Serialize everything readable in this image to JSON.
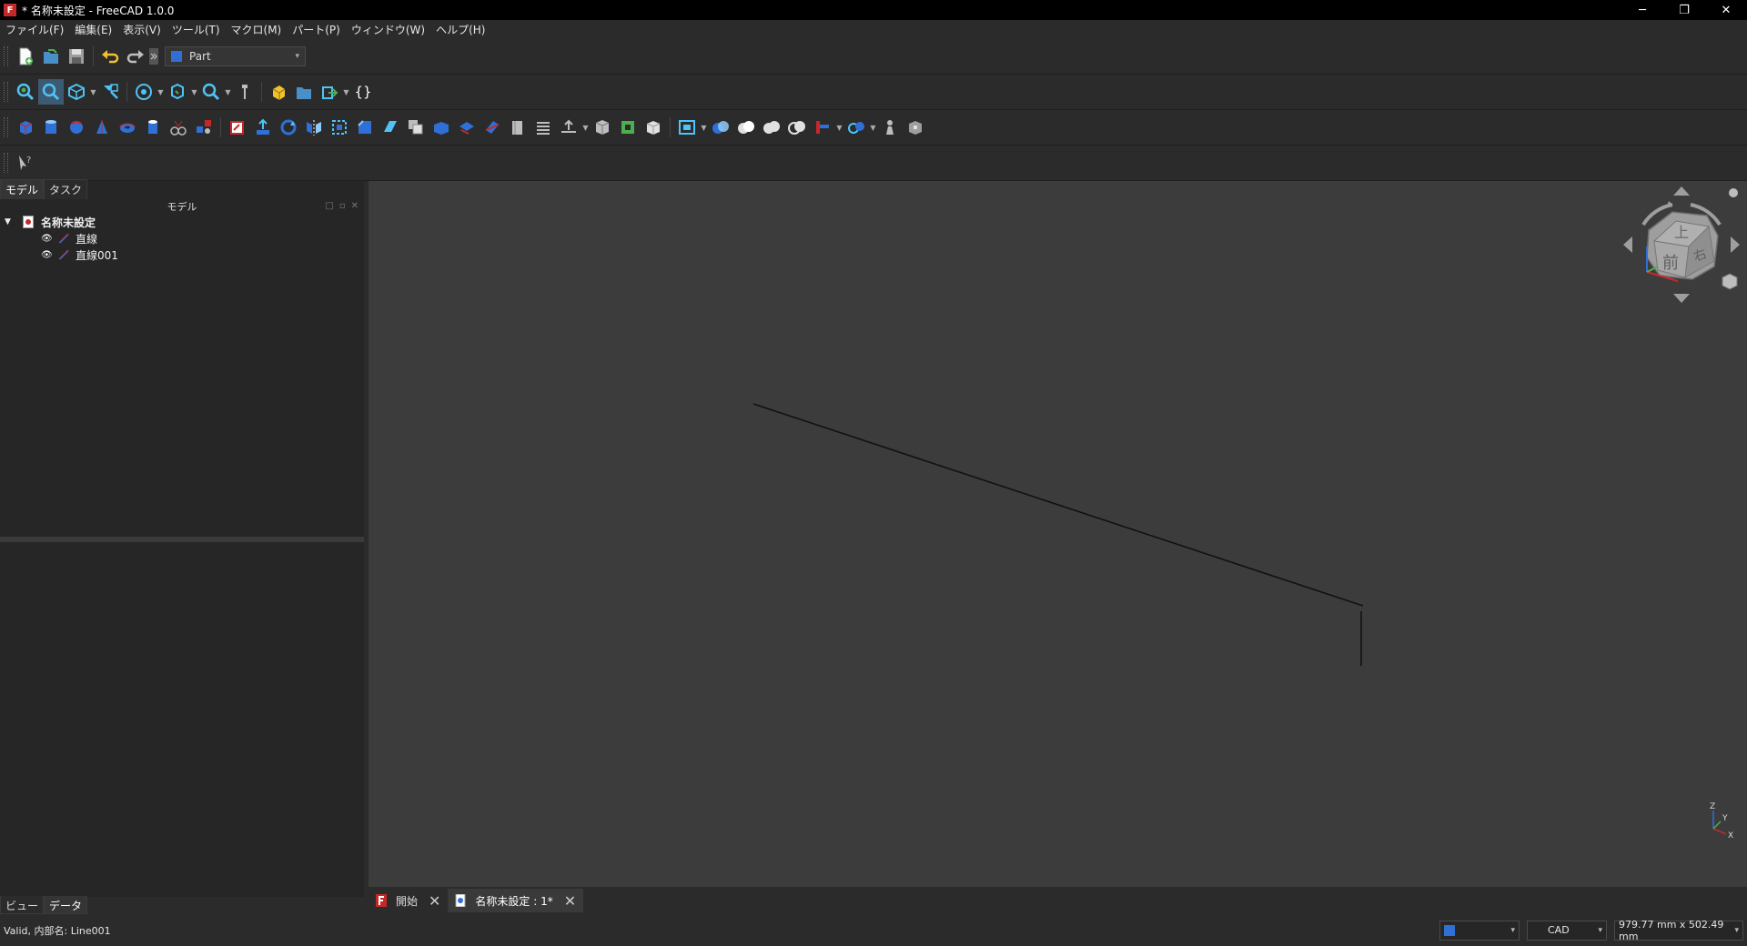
{
  "window": {
    "title": "* 名称未設定 - FreeCAD 1.0.0",
    "app_icon": "freecad-logo-icon",
    "app_icon_letter": "F",
    "minimize_glyph": "─",
    "restore_glyph": "❐",
    "close_glyph": "✕"
  },
  "menu": [
    {
      "label": "ファイル(F)"
    },
    {
      "label": "編集(E)"
    },
    {
      "label": "表示(V)"
    },
    {
      "label": "ツール(T)"
    },
    {
      "label": "マクロ(M)"
    },
    {
      "label": "パート(P)"
    },
    {
      "label": "ウィンドウ(W)"
    },
    {
      "label": "ヘルプ(H)"
    }
  ],
  "workbench": {
    "selected": "Part",
    "caret": "▾",
    "icon": "part-workbench-icon"
  },
  "macro_toolbar": {
    "braces_label": "{}"
  },
  "combo_view": {
    "tabs": [
      {
        "label": "モデル"
      },
      {
        "label": "タスク"
      }
    ],
    "model_header": "モデル",
    "header_buttons": [
      "□",
      "▫",
      "✕"
    ],
    "bottom_tabs": [
      {
        "label": "ビュー"
      },
      {
        "label": "データ"
      }
    ]
  },
  "tree": {
    "document": {
      "label": "名称未設定",
      "toggle": "▼",
      "icon": "document-icon"
    },
    "items": [
      {
        "label": "直線",
        "visible_glyph": "👁",
        "icon": "line-icon"
      },
      {
        "label": "直線001",
        "visible_glyph": "👁",
        "icon": "line-icon"
      }
    ]
  },
  "nav_cube": {
    "top_face": "上",
    "front_face": "前",
    "right_face": "右"
  },
  "axis_cross": {
    "x": "X",
    "y": "Y",
    "z": "Z"
  },
  "doc_tabs": [
    {
      "label": "開始",
      "icon": "freecad-start-icon",
      "close": "✕"
    },
    {
      "label": "名称未設定 : 1*",
      "icon": "document-icon",
      "close": "✕"
    }
  ],
  "status": {
    "text": "Valid, 内部名: Line001",
    "nav_style": "CAD",
    "dimensions": "979.77 mm x 502.49 mm",
    "caret": "▾"
  },
  "colors": {
    "accent_blue": "#2f6fd6",
    "freecad_red": "#c62828",
    "viewport_bg": "#3c3c3c"
  }
}
